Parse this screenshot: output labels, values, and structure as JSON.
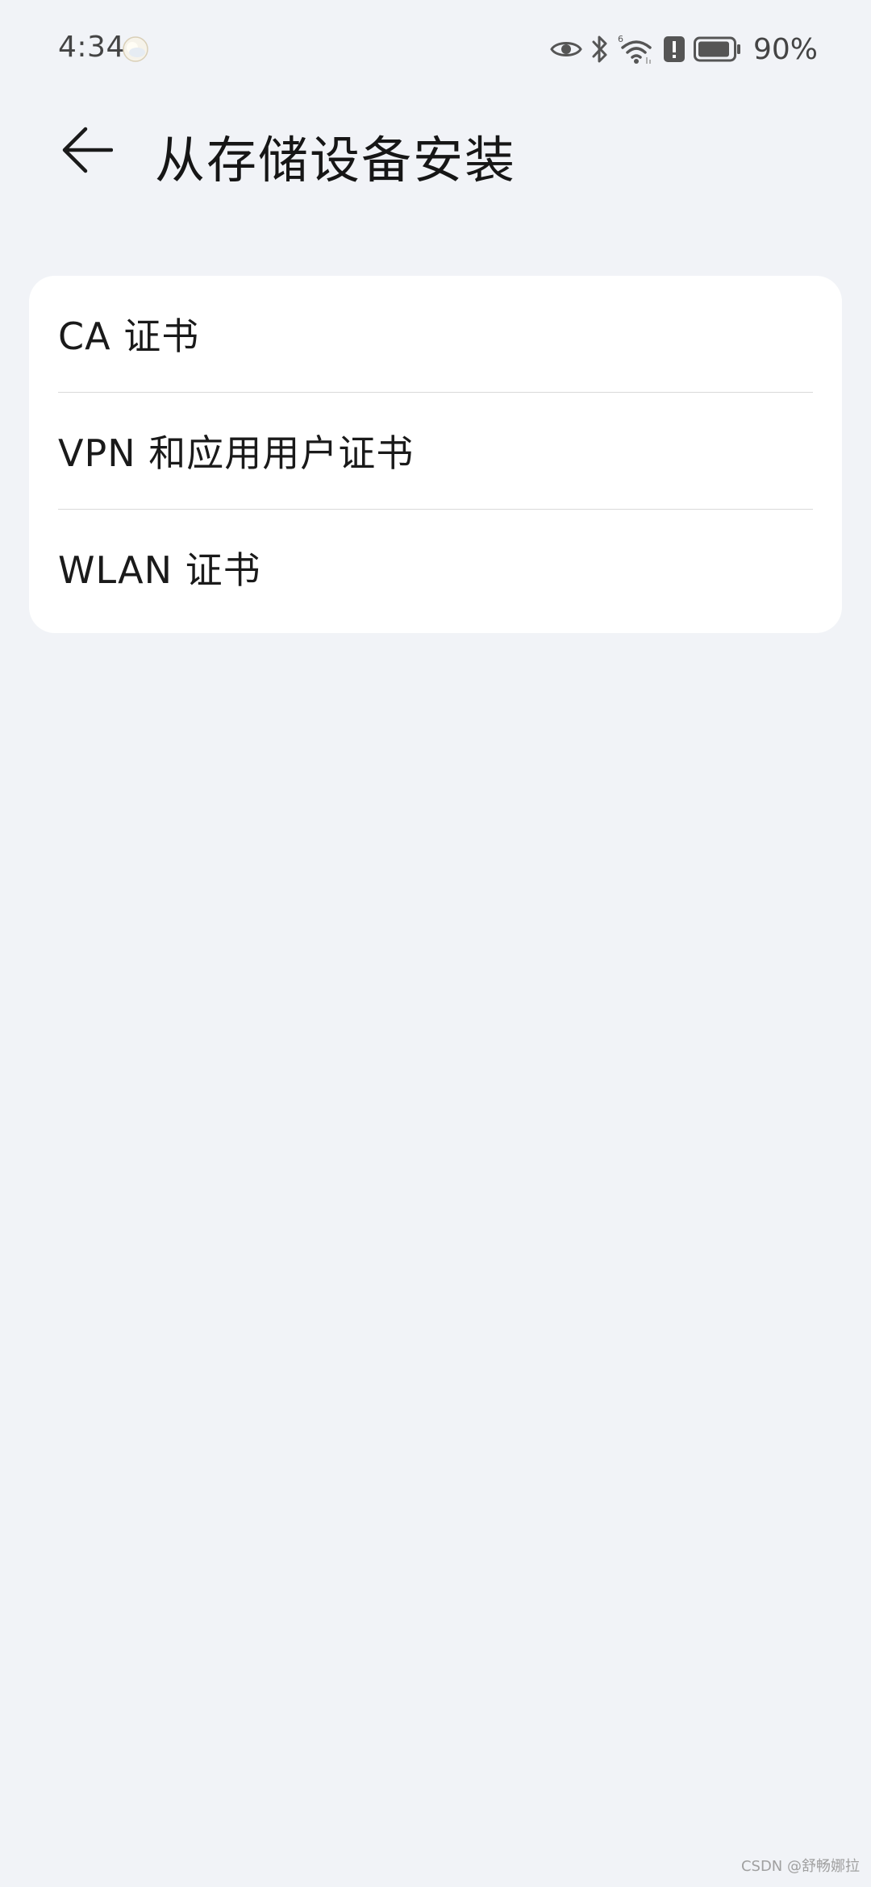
{
  "status_bar": {
    "time": "4:34",
    "battery_percent": "90%",
    "icons": [
      "weather-icon",
      "eye-icon",
      "bluetooth-icon",
      "wifi-6-icon",
      "alert-icon",
      "battery-icon"
    ]
  },
  "header": {
    "title": "从存储设备安装",
    "back_icon": "arrow-left-icon"
  },
  "list": {
    "items": [
      {
        "label": "CA 证书"
      },
      {
        "label": "VPN 和应用用户证书"
      },
      {
        "label": "WLAN 证书"
      }
    ]
  },
  "watermark": "CSDN @舒畅娜拉",
  "colors": {
    "background": "#f1f3f7",
    "card": "#ffffff",
    "text": "#1a1a1a",
    "divider": "#d9d9d9"
  }
}
